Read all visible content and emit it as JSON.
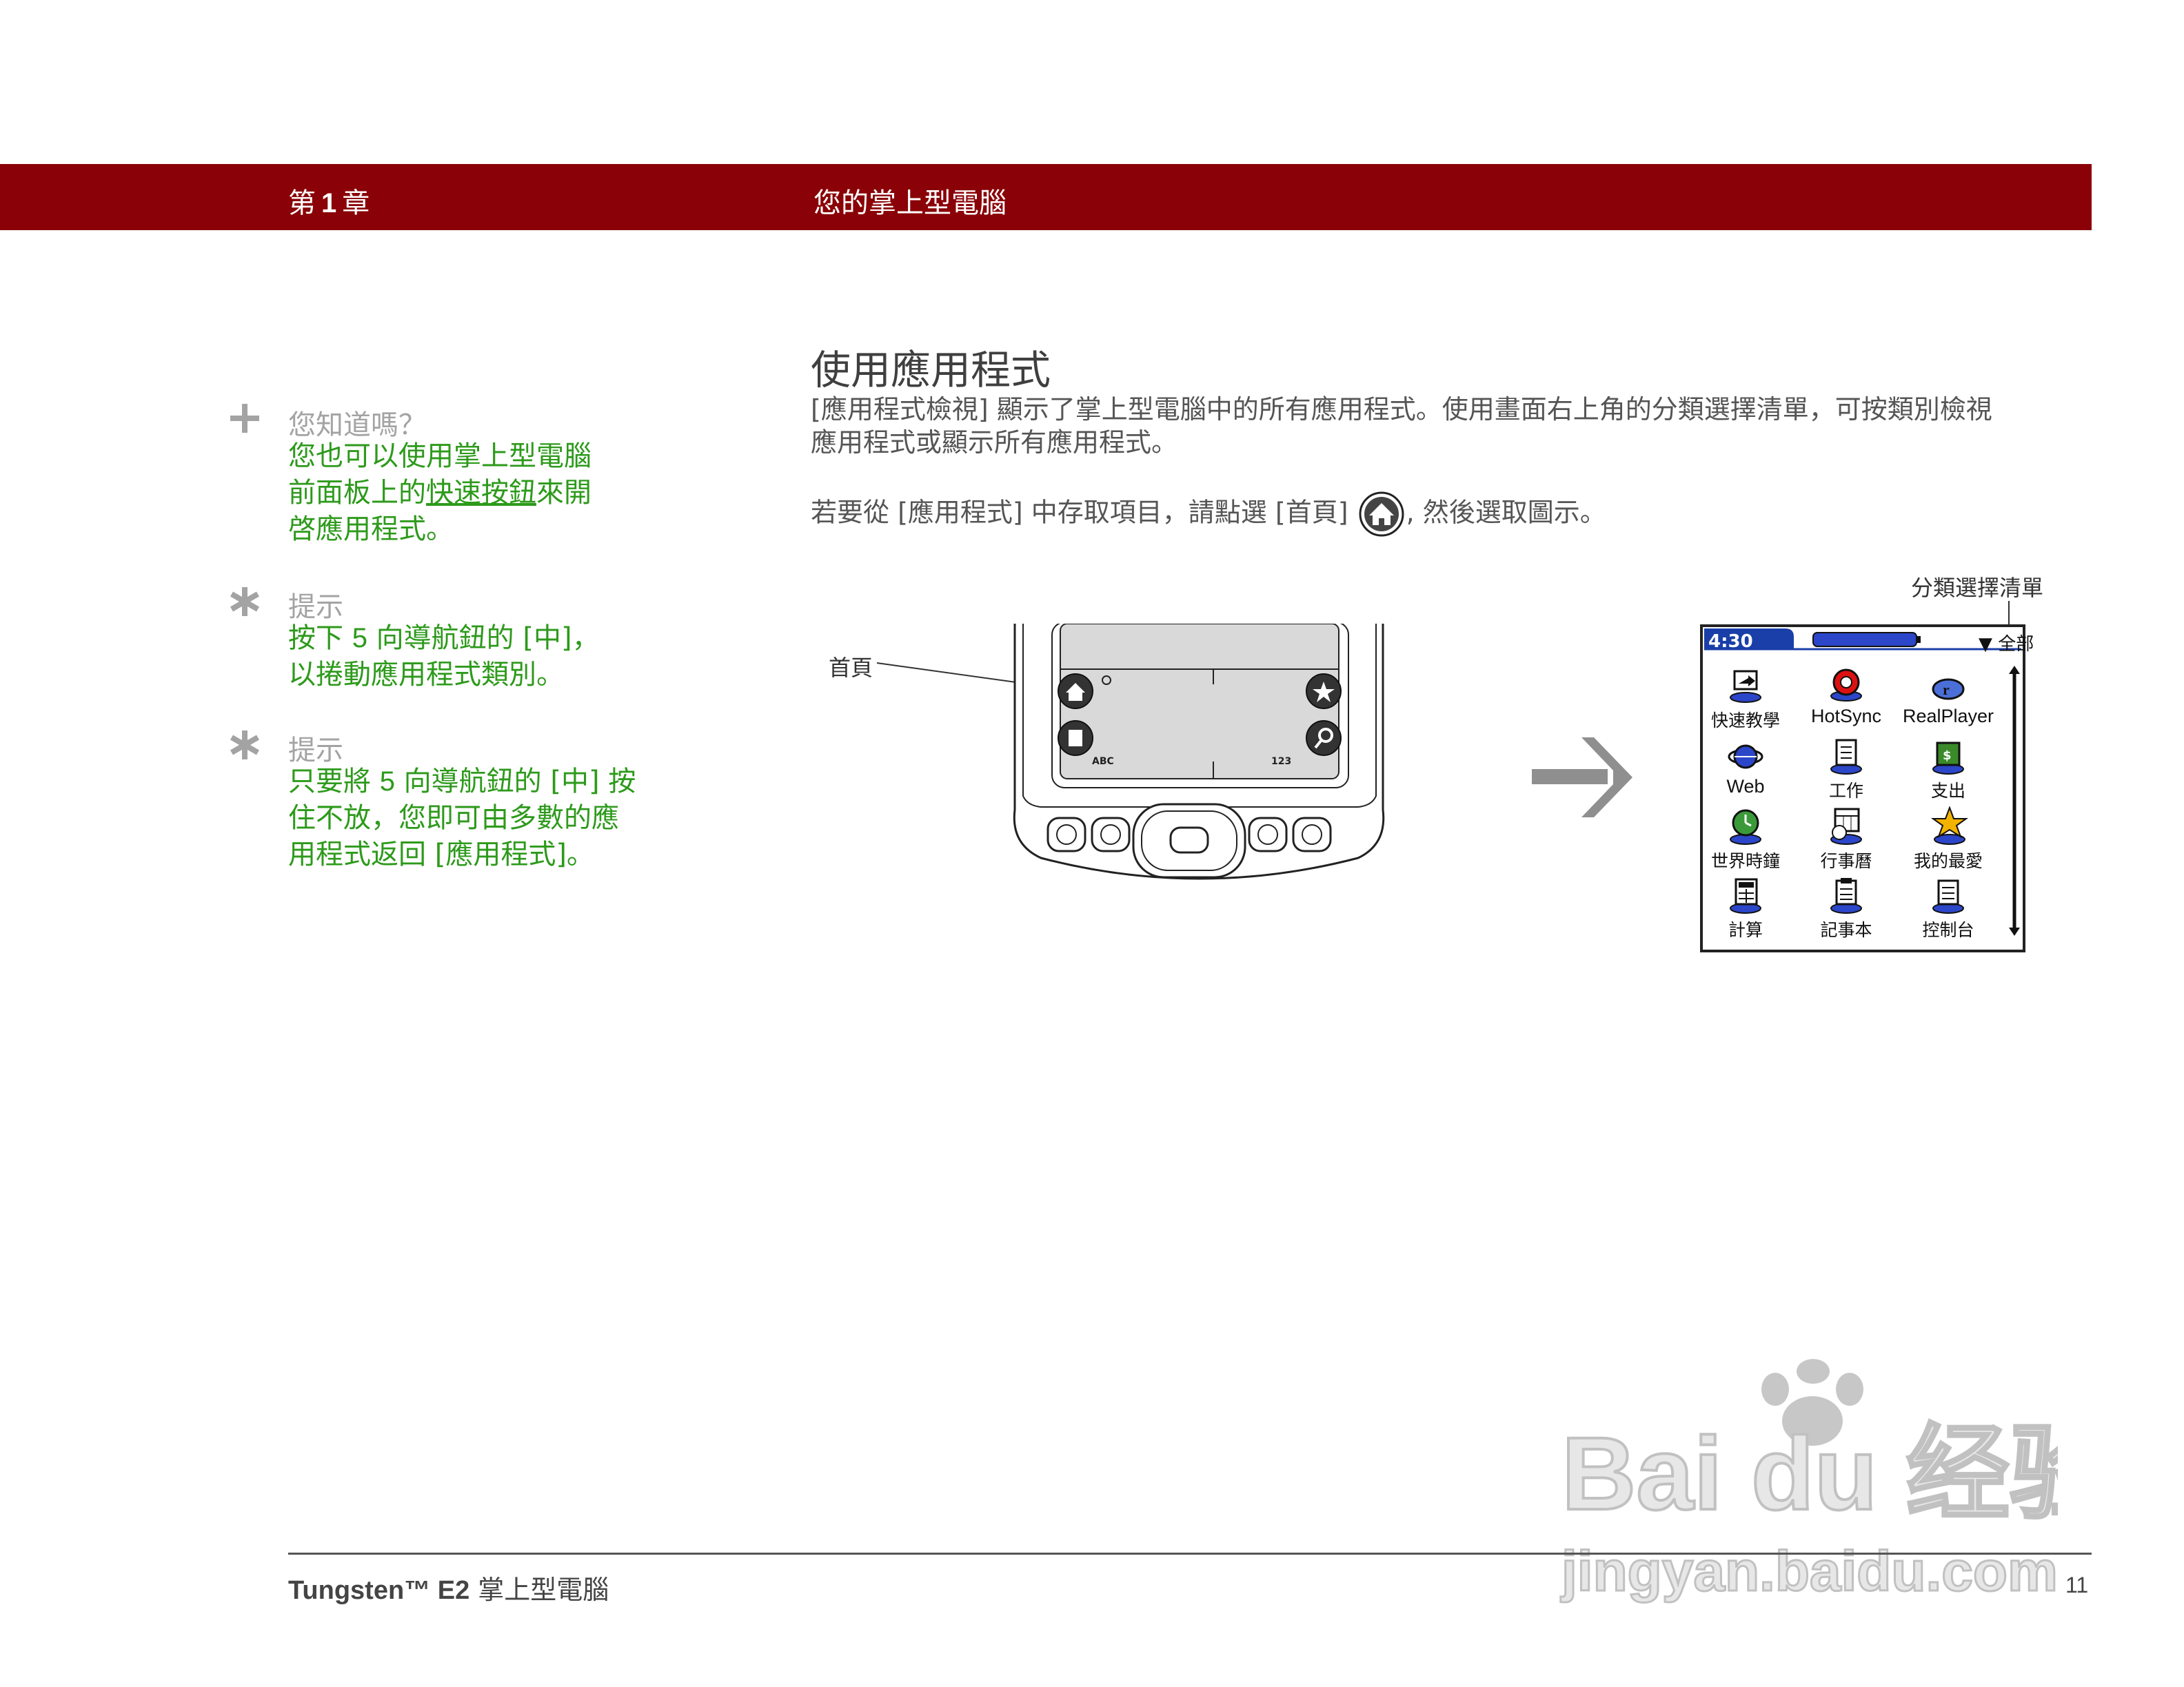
{
  "header": {
    "chapter_prefix": "第",
    "chapter_number": "1",
    "chapter_suffix": "章",
    "section_title": "您的掌上型電腦"
  },
  "sidebar": {
    "tip1": {
      "label": "您知道嗎？",
      "lines": [
        "您也可以使用掌上型電腦",
        "前面板上的",
        "快速按鈕",
        "來開",
        "啓應用程式。"
      ]
    },
    "tip2": {
      "label": "提示",
      "line1_a": "按下 ",
      "line1_num": "5",
      "line1_b": " 向導航鈕的 [中]，",
      "line2": "以捲動應用程式類別。"
    },
    "tip3": {
      "label": "提示",
      "line1_a": "只要將 ",
      "line1_num": "5",
      "line1_b": " 向導航鈕的 [中] 按",
      "line2": "住不放，您即可由多數的應",
      "line3": "用程式返回 [應用程式]。"
    }
  },
  "main": {
    "heading": "使用應用程式",
    "para1_line1": "[應用程式檢視] 顯示了掌上型電腦中的所有應用程式。使用畫面右上角的分類選擇清單，可按類別檢視",
    "para1_line2": "應用程式或顯示所有應用程式。",
    "para2_before": "若要從 [應用程式] 中存取項目，請點選 [首頁]",
    "para2_after": ", 然後選取圖示。"
  },
  "figure": {
    "callout_home": "首頁",
    "callout_category": "分類選擇清單",
    "device_label_left": "ABC",
    "device_label_right": "123",
    "screen": {
      "time": "4:30",
      "category": "▼ 全部",
      "apps": [
        {
          "label": "快速教學",
          "icon": "quick-tour-icon"
        },
        {
          "label": "HotSync",
          "icon": "hotsync-icon"
        },
        {
          "label": "RealPlayer",
          "icon": "realplayer-icon"
        },
        {
          "label": "Web",
          "icon": "web-icon"
        },
        {
          "label": "工作",
          "icon": "tasks-icon"
        },
        {
          "label": "支出",
          "icon": "expense-icon"
        },
        {
          "label": "世界時鐘",
          "icon": "world-clock-icon"
        },
        {
          "label": "行事曆",
          "icon": "calendar-icon"
        },
        {
          "label": "我的最愛",
          "icon": "favorites-icon"
        },
        {
          "label": "計算",
          "icon": "calculator-icon"
        },
        {
          "label": "記事本",
          "icon": "memo-icon"
        },
        {
          "label": "控制台",
          "icon": "prefs-icon"
        }
      ]
    }
  },
  "footer": {
    "product_bold": "Tungsten™ E2",
    "product_rest": " 掌上型電腦",
    "page_number": "11"
  },
  "watermark": {
    "brand": "Bai du 经验",
    "url": "jingyan.baidu.com"
  },
  "colors": {
    "header_band": "#8a0207",
    "tip_text": "#2d9a1b",
    "tip_label": "#a3a3a3",
    "screen_status_bar": "#1a3fa8"
  }
}
